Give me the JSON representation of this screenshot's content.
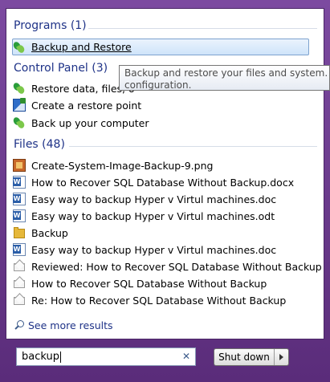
{
  "programs": {
    "header": "Programs (1)",
    "items": [
      {
        "label": "Backup and Restore",
        "icon": "backup-restore-icon"
      }
    ]
  },
  "control_panel": {
    "header": "Control Panel (3)",
    "items": [
      {
        "label": "Restore data, files, o",
        "icon": "backup-restore-icon"
      },
      {
        "label": "Create a restore point",
        "icon": "system-protection-icon"
      },
      {
        "label": "Back up your computer",
        "icon": "backup-restore-icon"
      }
    ]
  },
  "files": {
    "header": "Files (48)",
    "items": [
      {
        "label": "Create-System-Image-Backup-9.png",
        "icon": "png-image-icon"
      },
      {
        "label": "How to Recover SQL Database Without Backup.docx",
        "icon": "word-document-icon"
      },
      {
        "label": "Easy way to backup Hyper v Virtul machines.doc",
        "icon": "word-document-icon"
      },
      {
        "label": "Easy way to backup Hyper v Virtul machines.odt",
        "icon": "word-document-icon"
      },
      {
        "label": "Backup",
        "icon": "folder-icon"
      },
      {
        "label": "Easy way to backup Hyper v Virtul machines.doc",
        "icon": "word-document-icon"
      },
      {
        "label": "Reviewed: How to Recover SQL Database Without Backup",
        "icon": "email-icon"
      },
      {
        "label": "How to Recover SQL Database Without Backup",
        "icon": "email-icon"
      },
      {
        "label": "Re: How to Recover SQL Database Without Backup",
        "icon": "email-icon"
      }
    ]
  },
  "tooltip": {
    "line1": "Backup and restore your files and system. Monito",
    "line2": "configuration."
  },
  "see_more": "See more results",
  "search": {
    "value": "backup"
  },
  "shutdown": {
    "label": "Shut down"
  },
  "colors": {
    "header": "#1e3287",
    "frame": "#6d3a8f",
    "selection": "#cfe4fa"
  }
}
